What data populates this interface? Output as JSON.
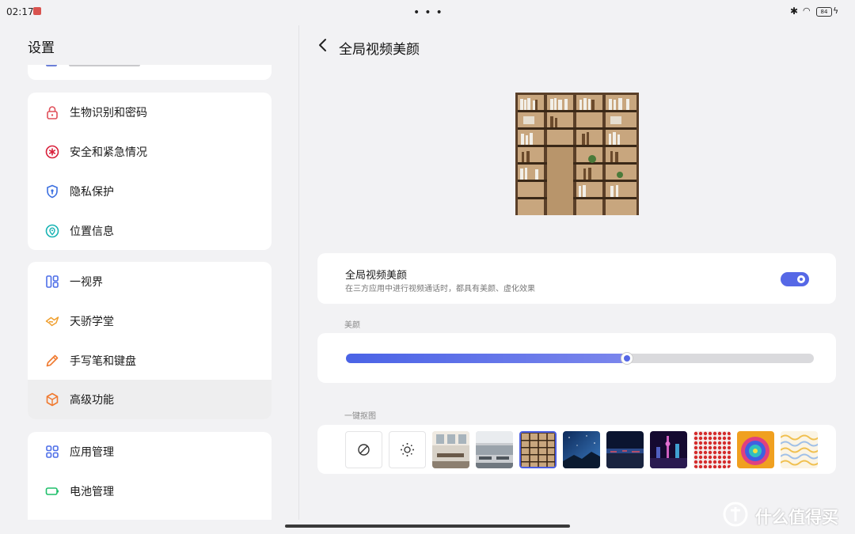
{
  "status_bar": {
    "time": "02:17",
    "battery": "84"
  },
  "settings": {
    "title": "设置",
    "groups": [
      {
        "items": [
          {
            "label": "生物识别和密码",
            "icon": "lock-icon",
            "color": "#e0505a"
          },
          {
            "label": "安全和紧急情况",
            "icon": "emergency-icon",
            "color": "#d81f3a"
          },
          {
            "label": "隐私保护",
            "icon": "shield-icon",
            "color": "#3b6fe0"
          },
          {
            "label": "位置信息",
            "icon": "location-pin-icon",
            "color": "#17b3b3"
          }
        ]
      },
      {
        "items": [
          {
            "label": "一视界",
            "icon": "split-screen-icon",
            "color": "#4d6ee8"
          },
          {
            "label": "天骄学堂",
            "icon": "learning-icon",
            "color": "#f0a030"
          },
          {
            "label": "手写笔和键盘",
            "icon": "pen-icon",
            "color": "#f07a30"
          },
          {
            "label": "高级功能",
            "icon": "hexagon-icon",
            "color": "#f07a30",
            "active": true
          }
        ]
      },
      {
        "items": [
          {
            "label": "应用管理",
            "icon": "apps-grid-icon",
            "color": "#4d6ee8"
          },
          {
            "label": "电池管理",
            "icon": "battery-icon",
            "color": "#1fbf6a"
          }
        ]
      }
    ]
  },
  "detail": {
    "title": "全局视频美颜",
    "preview_icon": "bookshelf-background-image",
    "toggle": {
      "title": "全局视频美颜",
      "subtitle": "在三方应用中进行视频通话时，都具有美颜、虚化效果",
      "on": true
    },
    "beauty": {
      "label": "美颜",
      "level_percent": 60
    },
    "cutout": {
      "label": "一键抠图",
      "options": [
        {
          "icon": "none-icon"
        },
        {
          "icon": "blur-icon"
        }
      ],
      "backgrounds": [
        {
          "icon": "office-room-background"
        },
        {
          "icon": "open-office-background"
        },
        {
          "icon": "bookshelf-background",
          "selected": true
        },
        {
          "icon": "starry-sky-background"
        },
        {
          "icon": "night-road-background"
        },
        {
          "icon": "city-skyline-background"
        },
        {
          "icon": "red-pattern-background"
        },
        {
          "icon": "colorful-swirl-background"
        },
        {
          "icon": "wavy-lines-background"
        }
      ]
    }
  },
  "colors": {
    "accent": "#5668e6"
  },
  "watermark": {
    "text": "什么值得买"
  }
}
